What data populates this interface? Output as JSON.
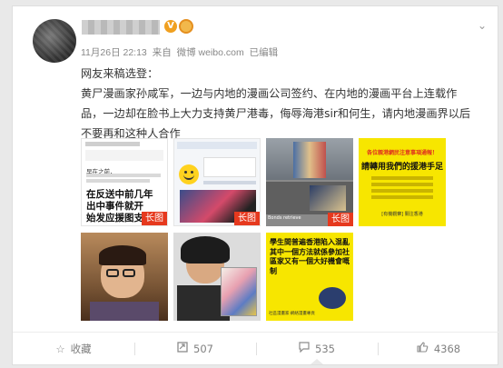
{
  "post": {
    "verified_badge": "V",
    "timestamp": "11月26日 22:13",
    "source_prefix": "来自",
    "source": "微博 weibo.com",
    "edited": "已编辑",
    "lines": [
      "网友来稿选登：",
      "黄尸漫画家孙咸军，一边与内地的漫画公司签约、在内地的漫画平台上连载作",
      "品，一边却在脸书上大力支持黄尸港毒，侮辱海港sir和何生，请内地漫画界以后",
      "不要再和这种人合作"
    ]
  },
  "images": {
    "long_tag": "长图",
    "img1": {
      "text1": "早在之前，",
      "text2": "在反送中前几年",
      "text3": "出中事件就开",
      "text4": "始发应援图支持"
    },
    "img3": {
      "caption": "Bonds retrieve"
    },
    "img4": {
      "line1": "各位親港網民注意事項通報！",
      "line2": "請轉用我們的援港手足",
      "footer": "[有機觀察] 關注香港"
    },
    "img7": {
      "text": "學生間普遍香港陷入混亂其中一個方法就係參加社區家又有一個大好機會嘅制",
      "credit": "社區漫畫家·網絡漫畫專頁"
    }
  },
  "actions": {
    "favorite": "收藏",
    "repost": "507",
    "comment": "535",
    "like": "4368"
  },
  "colors": {
    "accent_red": "#e6391e",
    "badge_orange": "#f0a020",
    "yellow_poster": "#f7e600"
  }
}
